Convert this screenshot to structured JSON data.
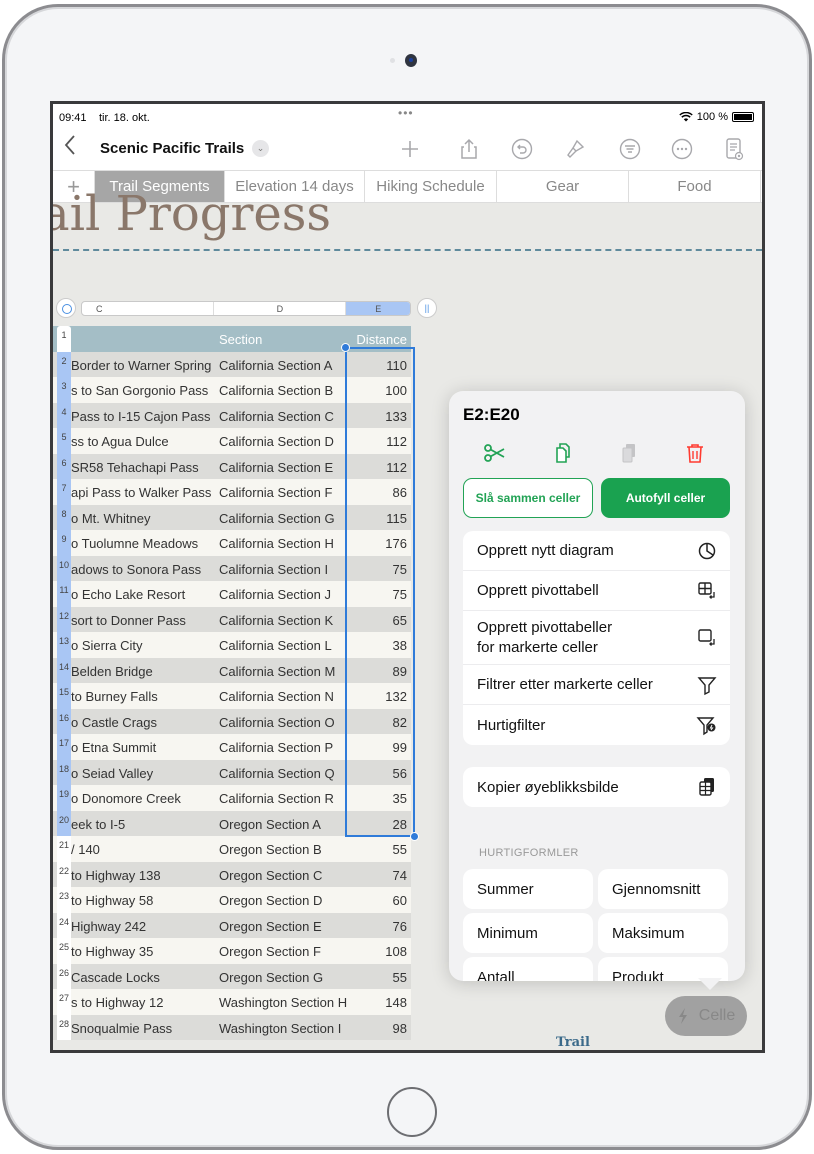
{
  "status_bar": {
    "time": "09:41",
    "date": "tir. 18. okt.",
    "dots": "•••",
    "battery": "100 %"
  },
  "toolbar": {
    "back_icon": "chevron-left-icon",
    "title": "Scenic Pacific Trails",
    "title_chevron": "chevron-down-icon",
    "icons": [
      "plus-icon",
      "share-icon",
      "undo-icon",
      "paintbrush-icon",
      "format-icon",
      "more-icon",
      "reader-view-icon"
    ]
  },
  "tabs": {
    "add_label": "+",
    "items": [
      {
        "label": "Trail Segments",
        "active": true
      },
      {
        "label": "Elevation 14 days",
        "active": false
      },
      {
        "label": "Hiking Schedule",
        "active": false
      },
      {
        "label": "Gear",
        "active": false
      },
      {
        "label": "Food",
        "active": false
      }
    ]
  },
  "canvas": {
    "title": "ail Progress",
    "footer_label": "Trail"
  },
  "table": {
    "column_letters": [
      "C",
      "D",
      "E"
    ],
    "selected_column": "E",
    "header": {
      "row": "1",
      "c": "",
      "d": "Section",
      "e": "Distance"
    },
    "rows": [
      {
        "n": "2",
        "c": "Border to Warner Springs",
        "d": "California Section A",
        "e": "110"
      },
      {
        "n": "3",
        "c": "s to San Gorgonio Pass",
        "d": "California Section B",
        "e": "100"
      },
      {
        "n": "4",
        "c": "Pass to I-15 Cajon Pass",
        "d": "California Section C",
        "e": "133"
      },
      {
        "n": "5",
        "c": "ss to Agua Dulce",
        "d": "California Section D",
        "e": "112"
      },
      {
        "n": "6",
        "c": "SR58 Tehachapi Pass",
        "d": "California Section E",
        "e": "112"
      },
      {
        "n": "7",
        "c": "api Pass to Walker Pass",
        "d": "California Section F",
        "e": "86"
      },
      {
        "n": "8",
        "c": "o Mt. Whitney",
        "d": "California Section G",
        "e": "115"
      },
      {
        "n": "9",
        "c": "o Tuolumne Meadows",
        "d": "California Section H",
        "e": "176"
      },
      {
        "n": "10",
        "c": "adows to Sonora Pass",
        "d": "California Section I",
        "e": "75"
      },
      {
        "n": "11",
        "c": "o Echo Lake Resort",
        "d": "California Section J",
        "e": "75"
      },
      {
        "n": "12",
        "c": "sort to Donner Pass",
        "d": "California Section K",
        "e": "65"
      },
      {
        "n": "13",
        "c": "o Sierra City",
        "d": "California Section L",
        "e": "38"
      },
      {
        "n": "14",
        "c": "Belden Bridge",
        "d": "California Section M",
        "e": "89"
      },
      {
        "n": "15",
        "c": "to Burney Falls",
        "d": "California Section N",
        "e": "132"
      },
      {
        "n": "16",
        "c": "o Castle Crags",
        "d": "California Section O",
        "e": "82"
      },
      {
        "n": "17",
        "c": "o Etna Summit",
        "d": "California Section P",
        "e": "99"
      },
      {
        "n": "18",
        "c": "o Seiad Valley",
        "d": "California Section Q",
        "e": "56"
      },
      {
        "n": "19",
        "c": "o Donomore Creek",
        "d": "California Section R",
        "e": "35"
      },
      {
        "n": "20",
        "c": "eek to I-5",
        "d": "Oregon Section A",
        "e": "28"
      },
      {
        "n": "21",
        "c": "/ 140",
        "d": "Oregon Section B",
        "e": "55"
      },
      {
        "n": "22",
        "c": "to Highway 138",
        "d": "Oregon Section C",
        "e": "74"
      },
      {
        "n": "23",
        "c": "to Highway 58",
        "d": "Oregon Section D",
        "e": "60"
      },
      {
        "n": "24",
        "c": "Highway 242",
        "d": "Oregon Section E",
        "e": "76"
      },
      {
        "n": "25",
        "c": "to Highway 35",
        "d": "Oregon Section F",
        "e": "108"
      },
      {
        "n": "26",
        "c": "Cascade Locks",
        "d": "Oregon Section G",
        "e": "55"
      },
      {
        "n": "27",
        "c": "s to Highway 12",
        "d": "Washington Section H",
        "e": "148"
      },
      {
        "n": "28",
        "c": "Snoqualmie Pass",
        "d": "Washington Section I",
        "e": "98"
      }
    ]
  },
  "popover": {
    "range": "E2:E20",
    "actions": [
      {
        "icon": "scissors-icon",
        "label": "cut",
        "color": "#22a355",
        "enabled": true
      },
      {
        "icon": "copy-icon",
        "label": "copy",
        "color": "#22a355",
        "enabled": true
      },
      {
        "icon": "paste-icon",
        "label": "paste",
        "color": "#c4c4c6",
        "enabled": false
      },
      {
        "icon": "trash-icon",
        "label": "delete",
        "color": "#ff3b30",
        "enabled": true
      }
    ],
    "merge_label": "Slå sammen celler",
    "autofill_label": "Autofyll celler",
    "menu": [
      {
        "label": "Opprett nytt diagram",
        "icon": "chart-pie-icon"
      },
      {
        "label": "Opprett pivottabell",
        "icon": "pivot-table-icon"
      },
      {
        "label": "Opprett pivottabeller",
        "label2": "for markerte celler",
        "icon": "pivot-selection-icon"
      },
      {
        "label": "Filtrer etter markerte celler",
        "icon": "filter-icon"
      },
      {
        "label": "Hurtigfilter",
        "icon": "quick-filter-icon"
      }
    ],
    "snapshot_label": "Kopier øyeblikksbilde",
    "snapshot_icon": "snapshot-icon",
    "formulas_heading": "HURTIGFORMLER",
    "formulas": [
      "Summer",
      "Gjennomsnitt",
      "Minimum",
      "Maksimum",
      "Antall",
      "Produkt"
    ]
  },
  "cell_button": {
    "icon": "lightning-icon",
    "label": "Celle"
  },
  "colors": {
    "accent_green": "#1aa250",
    "selection_blue": "#2f7bd9",
    "delete_red": "#ff3b30",
    "header_teal": "#a4bec6"
  }
}
